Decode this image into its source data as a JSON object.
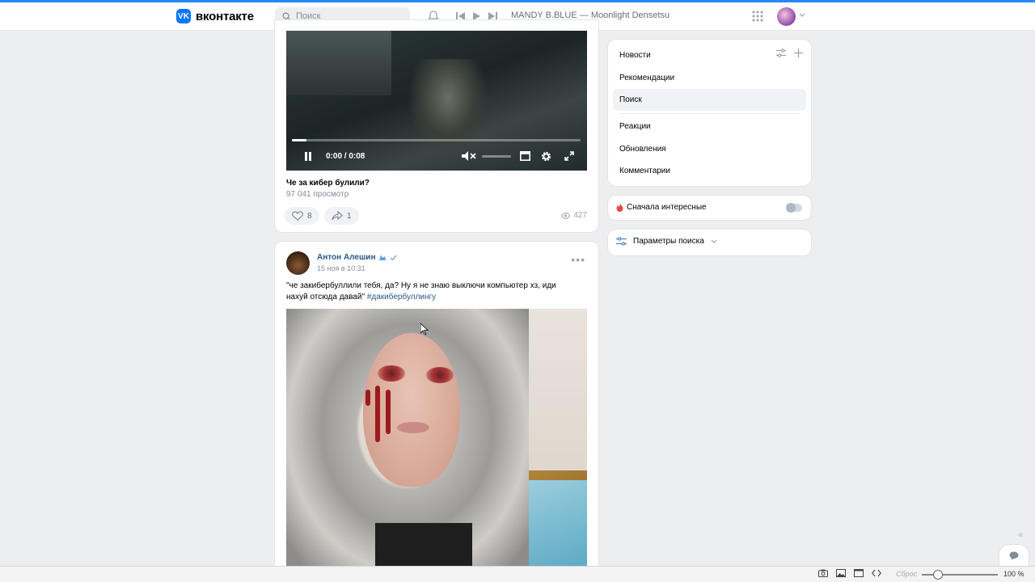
{
  "header": {
    "logo_text": "вконтакте",
    "search_placeholder": "Поиск",
    "track": "MANDY B.BLUE — Moonlight Densetsu"
  },
  "post1": {
    "video_time": "0:00 / 0:08",
    "video_progress": 0.05,
    "title": "Че за кибер булили?",
    "views_text": "97 041 просмотр",
    "likes": "8",
    "shares": "1",
    "views": "427"
  },
  "post2": {
    "author": "Антон Алешин",
    "date": "15 ноя в 10:31",
    "text": "\"че закибербуллили тебя, да? Ну я не знаю выключи компьютер хз, иди нахуй отсюда давай\"",
    "hashtag": "#дакибербуллингу"
  },
  "sidebar": {
    "nav": [
      {
        "label": "Новости"
      },
      {
        "label": "Рекомендации"
      },
      {
        "label": "Поиск"
      },
      {
        "label": "Реакции"
      },
      {
        "label": "Обновления"
      },
      {
        "label": "Комментарии"
      }
    ],
    "interesting_label": "Сначала интересные",
    "params_label": "Параметры поиска"
  },
  "statusbar": {
    "reset": "Сброс",
    "zoom": "100 %"
  },
  "colors": {
    "accent": "#0077ff",
    "link": "#2a5885",
    "bg": "#edeef0"
  }
}
